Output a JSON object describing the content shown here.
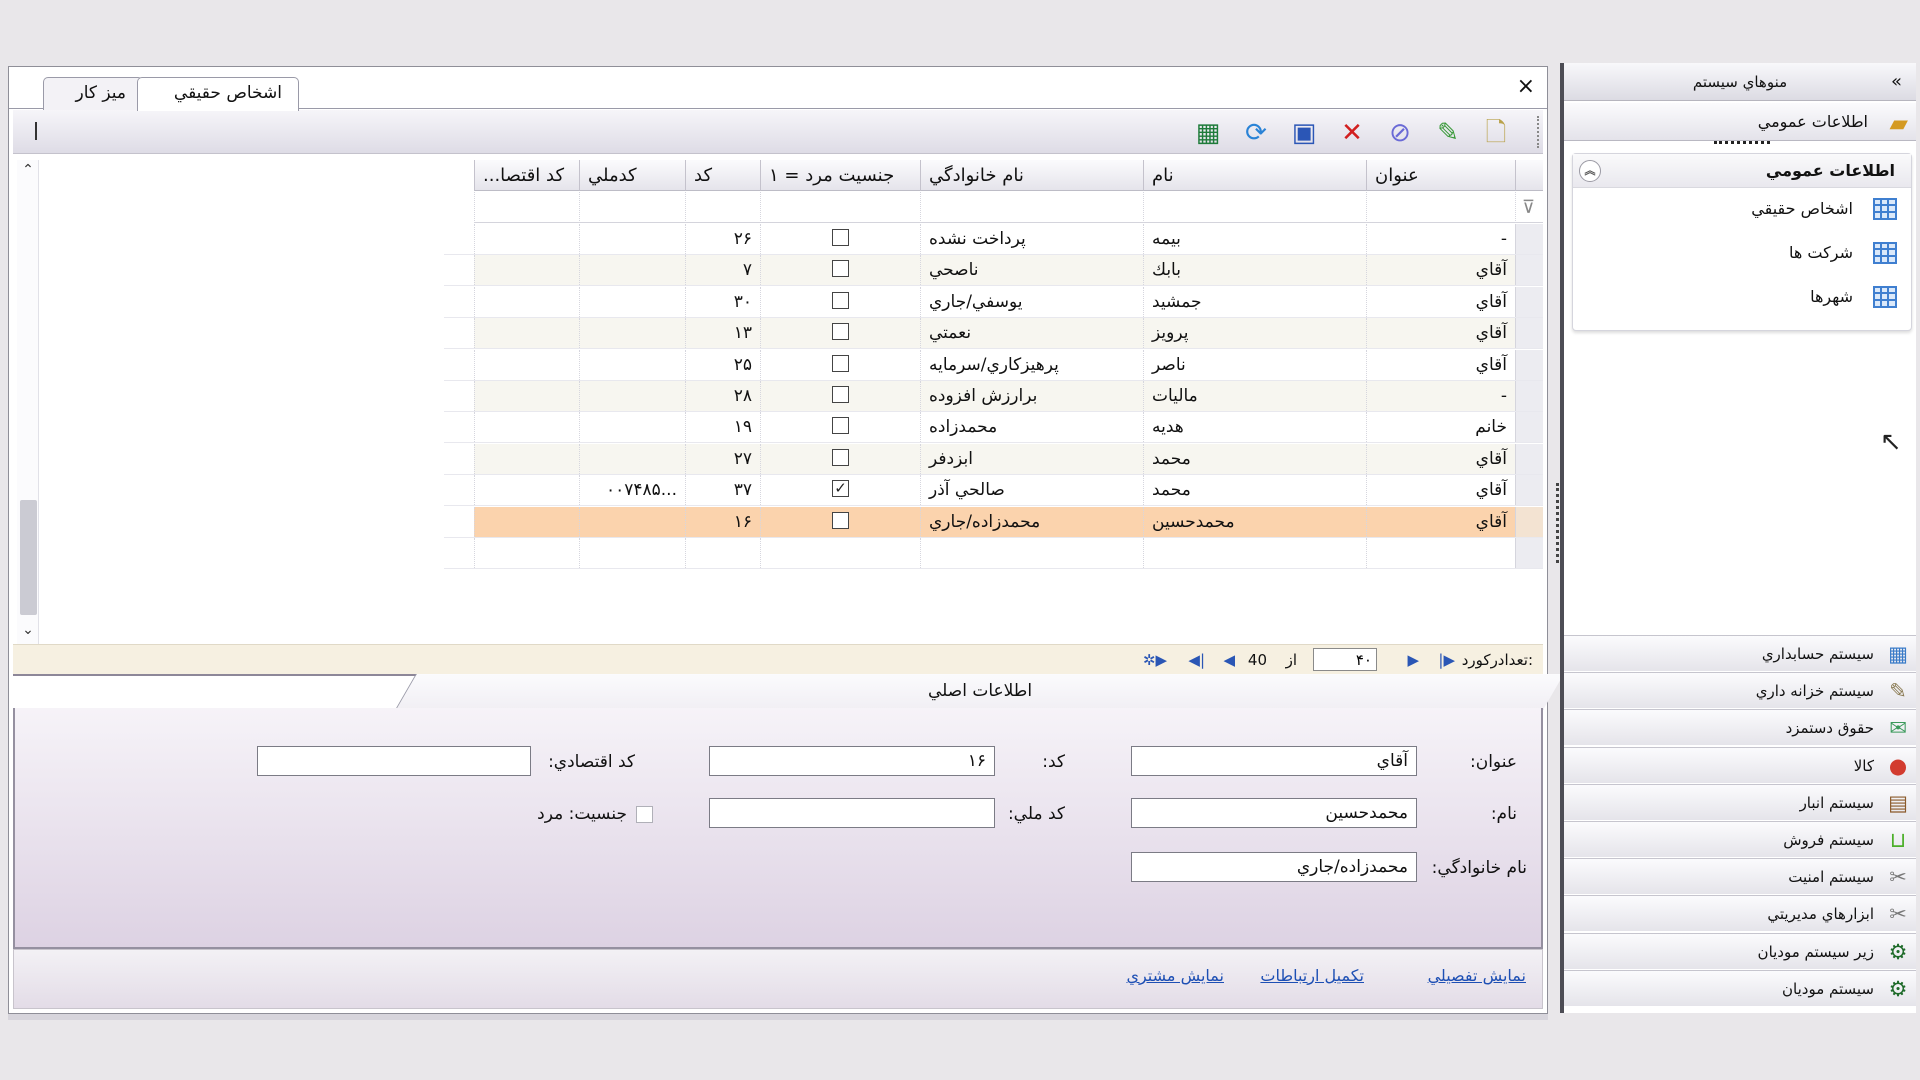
{
  "tabs": [
    {
      "label": "اشخاص حقيقي",
      "active": true
    },
    {
      "label": "ميز كار",
      "active": false
    }
  ],
  "close_symbol": "×",
  "toolbar": {
    "icons": [
      "new-document-icon",
      "edit-icon",
      "search-icon",
      "delete-icon",
      "cancel-icon",
      "save-icon",
      "refresh-icon",
      "excel-export-icon"
    ]
  },
  "grid": {
    "headers": [
      "عنوان",
      "نام",
      "نام خانوادگي",
      "جنسيت مرد = ۱",
      "كد",
      "كدملي",
      "كد اقتصا..."
    ],
    "rows": [
      {
        "title": "-",
        "first": "بيمه",
        "last": "پرداخت نشده",
        "male": false,
        "code": "۲۶",
        "national": "",
        "econ": ""
      },
      {
        "title": "آقاي",
        "first": "بابك",
        "last": "ناصحي",
        "male": false,
        "code": "۷",
        "national": "",
        "econ": ""
      },
      {
        "title": "آقاي",
        "first": "جمشيد",
        "last": "يوسفي/جاري",
        "male": false,
        "code": "۳۰",
        "national": "",
        "econ": ""
      },
      {
        "title": "آقاي",
        "first": "پرويز",
        "last": "نعمتي",
        "male": false,
        "code": "۱۳",
        "national": "",
        "econ": ""
      },
      {
        "title": "آقاي",
        "first": "ناصر",
        "last": "پرهيزكاري/سرمايه",
        "male": false,
        "code": "۲۵",
        "national": "",
        "econ": ""
      },
      {
        "title": "-",
        "first": "ماليات",
        "last": "برارزش افزوده",
        "male": false,
        "code": "۲۸",
        "national": "",
        "econ": ""
      },
      {
        "title": "خانم",
        "first": "هديه",
        "last": "محمدزاده",
        "male": false,
        "code": "۱۹",
        "national": "",
        "econ": ""
      },
      {
        "title": "آقاي",
        "first": "محمد",
        "last": "ابزدفر",
        "male": false,
        "code": "۲۷",
        "national": "",
        "econ": ""
      },
      {
        "title": "آقاي",
        "first": "محمد",
        "last": "صالحي آذر",
        "male": true,
        "code": "۳۷",
        "national": "...۰۰۷۴۸۵",
        "econ": ""
      },
      {
        "title": "آقاي",
        "first": "محمدحسين",
        "last": "محمدزاده/جاري",
        "male": false,
        "code": "۱۶",
        "national": "",
        "econ": "",
        "selected": true
      }
    ]
  },
  "pager": {
    "label": ":تعدادركورد",
    "current": "۴۰",
    "of": "از",
    "total": "40"
  },
  "detail": {
    "tab_label": "اطلاعات اصلي",
    "fields": {
      "title_label": "عنوان:",
      "title_value": "آقاي",
      "first_label": "نام:",
      "first_value": "محمدحسين",
      "last_label": "نام خانوادگي:",
      "last_value": "محمدزاده/جاري",
      "code_label": "كد:",
      "code_value": "۱۶",
      "national_label": "كد ملي:",
      "national_value": "",
      "econ_label": "كد اقتصادي:",
      "econ_value": "",
      "gender_label": "جنسيت: مرد"
    },
    "links": [
      "نمايش تفصيلي",
      "تكميل ارتباطات",
      "نمايش مشتري"
    ]
  },
  "side": {
    "title": "منوهاي سيستم",
    "collapse_symbol": "»",
    "group_bar": "اطلاعات عمومي",
    "tree_title": "اطلاعات عمومي",
    "tree_items": [
      "اشخاص حقيقي",
      "شركت ها",
      "شهرها"
    ],
    "systems": [
      {
        "label": "سيستم حسابداري",
        "icon": "calculator-icon",
        "glyph": "▦",
        "color": "#3a7bc8"
      },
      {
        "label": "سيستم خزانه داري",
        "icon": "treasury-icon",
        "glyph": "✎",
        "color": "#8a7a52"
      },
      {
        "label": "حقوق دستمزد",
        "icon": "payroll-icon",
        "glyph": "✉",
        "color": "#3b9a5b"
      },
      {
        "label": "كالا",
        "icon": "goods-icon",
        "glyph": "●",
        "color": "#d23b2f"
      },
      {
        "label": "سيستم انبار",
        "icon": "warehouse-icon",
        "glyph": "▤",
        "color": "#8b5a2b"
      },
      {
        "label": "سيستم فروش",
        "icon": "basket-icon",
        "glyph": "⊔",
        "color": "#4caf2a"
      },
      {
        "label": "سيستم امنيت",
        "icon": "wrench-icon",
        "glyph": "✂",
        "color": "#777777"
      },
      {
        "label": "ابزارهاي مديريتي",
        "icon": "tools-icon",
        "glyph": "✂",
        "color": "#777777"
      },
      {
        "label": "زير سيستم موديان",
        "icon": "gear-green-icon",
        "glyph": "⚙",
        "color": "#1f6b2a"
      },
      {
        "label": "سيستم موديان",
        "icon": "gear-green-icon",
        "glyph": "⚙",
        "color": "#1f6b2a"
      }
    ]
  }
}
